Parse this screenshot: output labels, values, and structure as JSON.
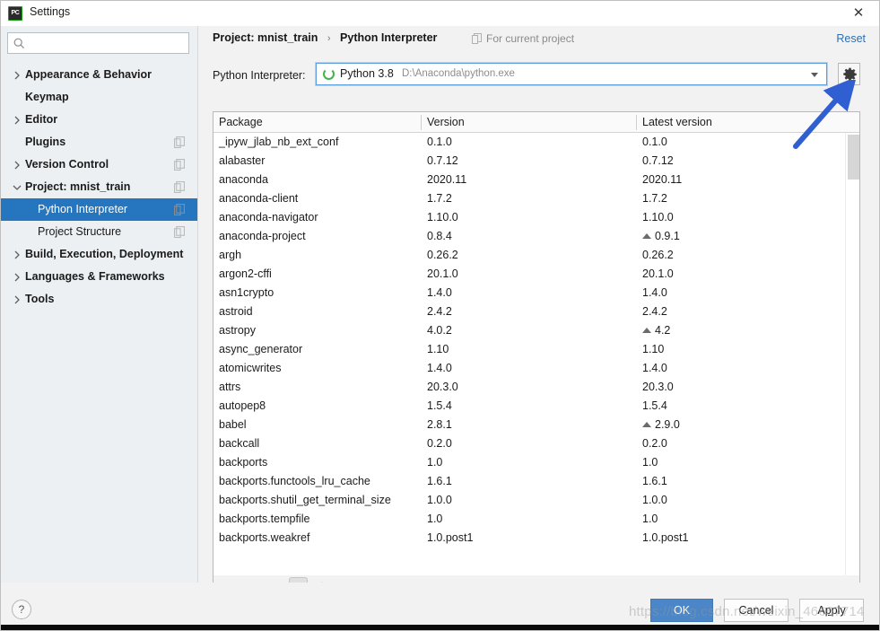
{
  "window": {
    "title": "Settings",
    "app_icon": "pycharm-icon",
    "close_label": "✕"
  },
  "sidebar": {
    "search": {
      "placeholder": "",
      "value": "",
      "icon": "search-icon"
    },
    "items": [
      {
        "label": "Appearance & Behavior",
        "depth": 0,
        "bold": true,
        "twisty": "right",
        "selected": false,
        "copy": false
      },
      {
        "label": "Keymap",
        "depth": 0,
        "bold": true,
        "twisty": "none",
        "selected": false,
        "copy": false
      },
      {
        "label": "Editor",
        "depth": 0,
        "bold": true,
        "twisty": "right",
        "selected": false,
        "copy": false
      },
      {
        "label": "Plugins",
        "depth": 0,
        "bold": true,
        "twisty": "none",
        "selected": false,
        "copy": true
      },
      {
        "label": "Version Control",
        "depth": 0,
        "bold": true,
        "twisty": "right",
        "selected": false,
        "copy": true
      },
      {
        "label": "Project: mnist_train",
        "depth": 0,
        "bold": true,
        "twisty": "down",
        "selected": false,
        "copy": true
      },
      {
        "label": "Python Interpreter",
        "depth": 1,
        "bold": false,
        "twisty": "none",
        "selected": true,
        "copy": true
      },
      {
        "label": "Project Structure",
        "depth": 1,
        "bold": false,
        "twisty": "none",
        "selected": false,
        "copy": true
      },
      {
        "label": "Build, Execution, Deployment",
        "depth": 0,
        "bold": true,
        "twisty": "right",
        "selected": false,
        "copy": false
      },
      {
        "label": "Languages & Frameworks",
        "depth": 0,
        "bold": true,
        "twisty": "right",
        "selected": false,
        "copy": false
      },
      {
        "label": "Tools",
        "depth": 0,
        "bold": true,
        "twisty": "right",
        "selected": false,
        "copy": false
      }
    ]
  },
  "header": {
    "breadcrumb_project": "Project: mnist_train",
    "breadcrumb_sep": "›",
    "breadcrumb_page": "Python Interpreter",
    "for_current_project": "For current project",
    "for_current_project_icon": "copy-settings-icon",
    "reset_label": "Reset"
  },
  "interpreter": {
    "label": "Python Interpreter:",
    "name": "Python 3.8",
    "path": "D:\\Anaconda\\python.exe",
    "status_icon": "python-env-icon",
    "dropdown_icon": "chevron-down-icon",
    "gear_icon": "gear-icon"
  },
  "table": {
    "columns": [
      "Package",
      "Version",
      "Latest version"
    ],
    "rows": [
      {
        "package": "_ipyw_jlab_nb_ext_conf",
        "version": "0.1.0",
        "latest": "0.1.0",
        "upgradable": false
      },
      {
        "package": "alabaster",
        "version": "0.7.12",
        "latest": "0.7.12",
        "upgradable": false
      },
      {
        "package": "anaconda",
        "version": "2020.11",
        "latest": "2020.11",
        "upgradable": false
      },
      {
        "package": "anaconda-client",
        "version": "1.7.2",
        "latest": "1.7.2",
        "upgradable": false
      },
      {
        "package": "anaconda-navigator",
        "version": "1.10.0",
        "latest": "1.10.0",
        "upgradable": false
      },
      {
        "package": "anaconda-project",
        "version": "0.8.4",
        "latest": "0.9.1",
        "upgradable": true
      },
      {
        "package": "argh",
        "version": "0.26.2",
        "latest": "0.26.2",
        "upgradable": false
      },
      {
        "package": "argon2-cffi",
        "version": "20.1.0",
        "latest": "20.1.0",
        "upgradable": false
      },
      {
        "package": "asn1crypto",
        "version": "1.4.0",
        "latest": "1.4.0",
        "upgradable": false
      },
      {
        "package": "astroid",
        "version": "2.4.2",
        "latest": "2.4.2",
        "upgradable": false
      },
      {
        "package": "astropy",
        "version": "4.0.2",
        "latest": "4.2",
        "upgradable": true
      },
      {
        "package": "async_generator",
        "version": "1.10",
        "latest": "1.10",
        "upgradable": false
      },
      {
        "package": "atomicwrites",
        "version": "1.4.0",
        "latest": "1.4.0",
        "upgradable": false
      },
      {
        "package": "attrs",
        "version": "20.3.0",
        "latest": "20.3.0",
        "upgradable": false
      },
      {
        "package": "autopep8",
        "version": "1.5.4",
        "latest": "1.5.4",
        "upgradable": false
      },
      {
        "package": "babel",
        "version": "2.8.1",
        "latest": "2.9.0",
        "upgradable": true
      },
      {
        "package": "backcall",
        "version": "0.2.0",
        "latest": "0.2.0",
        "upgradable": false
      },
      {
        "package": "backports",
        "version": "1.0",
        "latest": "1.0",
        "upgradable": false
      },
      {
        "package": "backports.functools_lru_cache",
        "version": "1.6.1",
        "latest": "1.6.1",
        "upgradable": false
      },
      {
        "package": "backports.shutil_get_terminal_size",
        "version": "1.0.0",
        "latest": "1.0.0",
        "upgradable": false
      },
      {
        "package": "backports.tempfile",
        "version": "1.0",
        "latest": "1.0",
        "upgradable": false
      },
      {
        "package": "backports.weakref",
        "version": "1.0.post1",
        "latest": "1.0.post1",
        "upgradable": false
      }
    ]
  },
  "table_toolbar": {
    "add": "+",
    "remove": "−",
    "upgrade": "upgrade-arrow-icon",
    "conda": "conda-env-icon",
    "show_early": "eye-icon"
  },
  "footer": {
    "help_label": "?",
    "ok_label": "OK",
    "cancel_label": "Cancel",
    "apply_label": "Apply"
  },
  "annotations": {
    "arrow": "blue-arrow-pointing-to-gear",
    "watermark": "https://blog.csdn.net/weixin_46667714"
  },
  "colors": {
    "selection_blue": "#2675bf",
    "link_blue": "#2f6fb5",
    "primary_button": "#4a86c8",
    "python_green": "#3fb54a",
    "annotation_blue": "#2f5fd0"
  }
}
